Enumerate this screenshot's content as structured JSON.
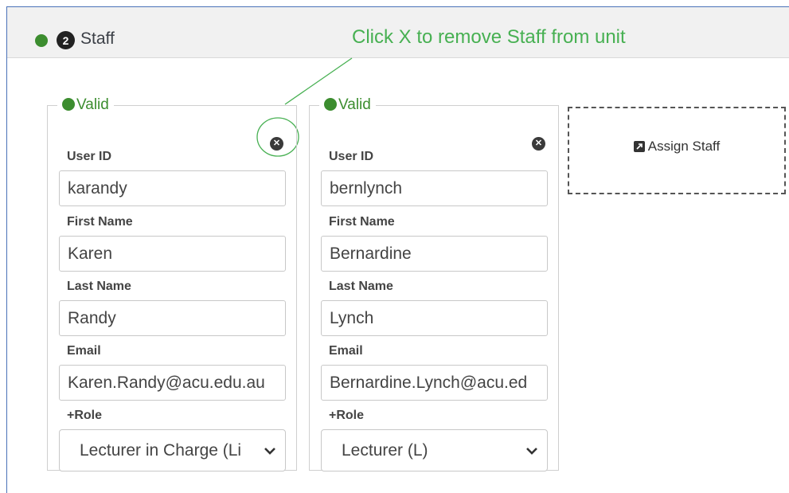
{
  "header": {
    "step_number": "2",
    "title": "Staff"
  },
  "annotation": {
    "text": "Click X to remove Staff from unit"
  },
  "cards": [
    {
      "status": "Valid",
      "fields": {
        "user_id": {
          "label": "User ID",
          "value": "karandy"
        },
        "first_name": {
          "label": "First Name",
          "value": "Karen"
        },
        "last_name": {
          "label": "Last Name",
          "value": "Randy"
        },
        "email": {
          "label": "Email",
          "value": "Karen.Randy@acu.edu.au"
        },
        "role": {
          "label": "+Role",
          "value": "Lecturer in Charge (Li"
        }
      }
    },
    {
      "status": "Valid",
      "fields": {
        "user_id": {
          "label": "User ID",
          "value": "bernlynch"
        },
        "first_name": {
          "label": "First Name",
          "value": "Bernardine"
        },
        "last_name": {
          "label": "Last Name",
          "value": "Lynch"
        },
        "email": {
          "label": "Email",
          "value": "Bernardine.Lynch@acu.ed"
        },
        "role": {
          "label": "+Role",
          "value": "Lecturer (L)"
        }
      }
    }
  ],
  "assign": {
    "label": "Assign Staff"
  },
  "colors": {
    "status_green": "#3c8d2f",
    "annotation_green": "#47b052",
    "frame_blue": "#4a72b8"
  }
}
